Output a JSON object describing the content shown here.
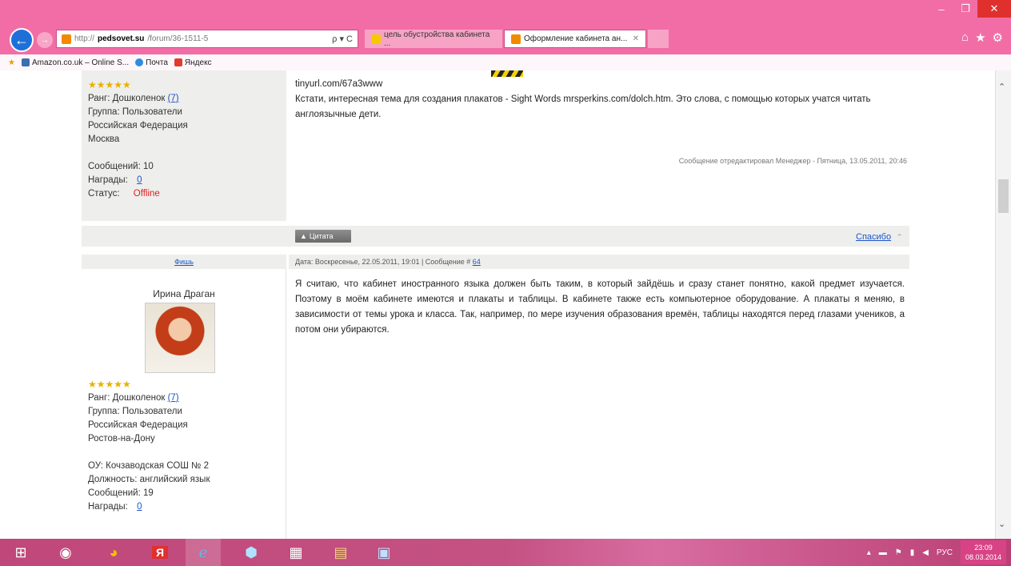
{
  "browser": {
    "url_prefix": "http://",
    "url_host": "pedsovet.su",
    "url_path": "/forum/36-1511-5",
    "addr_controls": "ρ ▾ C",
    "tabs": [
      {
        "title": "цель обустройства кабинета ...",
        "active": false,
        "icon_color": "#f5c800"
      },
      {
        "title": "Оформление кабинета ан...",
        "active": true,
        "icon_color": "#f08a00"
      }
    ],
    "favorites": [
      "Amazon.co.uk – Online S...",
      "Почта",
      "Яндекс"
    ],
    "accent": "#f26da6"
  },
  "post1": {
    "stars": "★★★★★",
    "rank_label": "Ранг:",
    "rank_value": "Дошколенок",
    "rank_link": "(7)",
    "group": "Группа: Пользователи",
    "country": "Российская Федерация",
    "city": "Москва",
    "messages": "Сообщений: 10",
    "awards_label": "Награды:",
    "awards_value": "0",
    "status_label": "Статус:",
    "status_value": "Offline",
    "line1": "tinyurl.com/67a3www",
    "line2": "Кстати, интересная тема для создания плакатов - Sight Words mrsperkins.com/dolch.htm. Это слова, с помощью которых учатся читать англоязычные дети.",
    "edited": "Сообщение отредактировал Менеджер - Пятница, 13.05.2011, 20:46",
    "reply_label": "Цитата",
    "thanks_label": "Спасибо"
  },
  "post2": {
    "link_label": "Фишь",
    "header": "Дата: Воскресенье, 22.05.2011, 19:01 | Сообщение # ",
    "msg_num": "64",
    "author": "Ирина Драган",
    "stars": "★★★★★",
    "rank_label": "Ранг:",
    "rank_value": "Дошколенок",
    "rank_link": "(7)",
    "group": "Группа: Пользователи",
    "country": "Российская Федерация",
    "city": "Ростов-на-Дону",
    "school": "ОУ: Кочзаводская СОШ № 2",
    "position": "Должность: английский язык",
    "messages": "Сообщений: 19",
    "awards_label": "Награды:",
    "awards_value": "0",
    "text": "Я считаю, что кабинет иностранного языка должен быть таким, в который зайдёшь и сразу станет понятно, какой предмет изучается. Поэтому в моём кабинете имеются и плакаты и таблицы. В кабинете также есть компьютерное оборудование. А плакаты я меняю, в зависимости от темы урока и класса. Так, например, по мере изучения образования времён, таблицы находятся перед глазами учеников, а потом они убираются."
  },
  "taskbar": {
    "lang": "РУС",
    "time": "23:09",
    "date": "08.03.2014"
  }
}
